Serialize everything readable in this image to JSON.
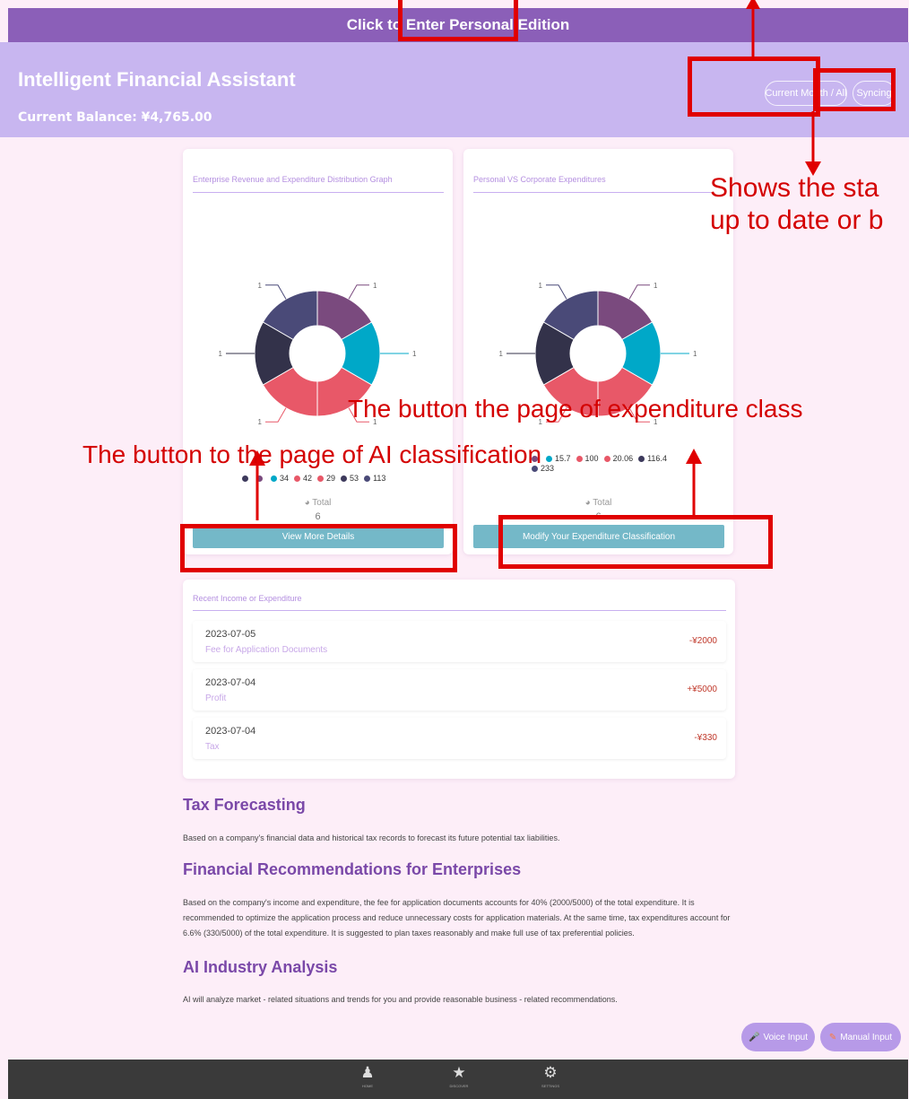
{
  "banner": {
    "text": "Click to Enter Personal Edition"
  },
  "header": {
    "title": "Intelligent Financial Assistant",
    "balance": "Current Balance: ¥4,765.00",
    "period_button": "Current Month / All",
    "sync_button": "Syncing"
  },
  "card1": {
    "title": "Enterprise Revenue and Expenditure Distribution Graph",
    "legend": [
      {
        "label": "",
        "color": "#3d3a5c"
      },
      {
        "label": "",
        "color": "#7a4a7e"
      },
      {
        "label": "34",
        "color": "#00a8c8"
      },
      {
        "label": "42",
        "color": "#e85868"
      },
      {
        "label": "29",
        "color": "#e85868"
      },
      {
        "label": "53",
        "color": "#3d3a5c"
      },
      {
        "label": "113",
        "color": "#4a4a78"
      }
    ],
    "total_label": "Total",
    "total_value": "6",
    "button": "View More Details"
  },
  "card2": {
    "title": "Personal VS Corporate Expenditures",
    "legend": [
      {
        "label": "",
        "color": "#7a4a7e"
      },
      {
        "label": "15.7",
        "color": "#00a8c8"
      },
      {
        "label": "100",
        "color": "#e85868"
      },
      {
        "label": "20.06",
        "color": "#e85868"
      },
      {
        "label": "116.4",
        "color": "#3d3a5c"
      },
      {
        "label": "233",
        "color": "#4a4a78"
      }
    ],
    "total_label": "Total",
    "total_value": "6",
    "button": "Modify Your Expenditure Classification"
  },
  "chart_data": [
    {
      "type": "pie",
      "title": "Enterprise Revenue and Expenditure Distribution Graph",
      "values": [
        1,
        1,
        1,
        1,
        1,
        1
      ],
      "labels": [
        "1",
        "1",
        "1",
        "1",
        "1",
        "1"
      ],
      "colors": [
        "#7a4a7e",
        "#00a8c8",
        "#e85868",
        "#e85868",
        "#33324a",
        "#4a4a78"
      ]
    },
    {
      "type": "pie",
      "title": "Personal VS Corporate Expenditures",
      "values": [
        1,
        1,
        1,
        1,
        1,
        1
      ],
      "labels": [
        "1",
        "1",
        "1",
        "1",
        "1",
        "1"
      ],
      "colors": [
        "#7a4a7e",
        "#00a8c8",
        "#e85868",
        "#e85868",
        "#33324a",
        "#4a4a78"
      ]
    }
  ],
  "recent": {
    "title": "Recent Income or Expenditure",
    "items": [
      {
        "date": "2023-07-05",
        "desc": "Fee for Application Documents",
        "amount": "-¥2000"
      },
      {
        "date": "2023-07-04",
        "desc": "Profit",
        "amount": "+¥5000"
      },
      {
        "date": "2023-07-04",
        "desc": "Tax",
        "amount": "-¥330"
      }
    ]
  },
  "sections": {
    "tax_title": "Tax Forecasting",
    "tax_text": "Based on a company's financial data and historical tax records to forecast its future potential tax liabilities.",
    "rec_title": "Financial Recommendations for Enterprises",
    "rec_text": "Based on the company's income and expenditure, the fee for application documents accounts for 40% (2000/5000) of the total expenditure. It is recommended to optimize the application process and reduce unnecessary costs for application materials. At the same time, tax expenditures account for 6.6% (330/5000) of the total expenditure. It is suggested to plan taxes reasonably and make full use of tax preferential policies.",
    "ai_title": "AI Industry Analysis",
    "ai_text": "AI will analyze market - related situations and trends for you and provide reasonable business - related recommendations."
  },
  "fab": {
    "voice": "Voice Input",
    "manual": "Manual Input"
  },
  "nav": {
    "home": "HOME",
    "discover": "DISCOVER",
    "settings": "SETTINGS"
  },
  "annotations": {
    "status_text": "Shows the sta up to date or b",
    "status_line1": "Shows the sta",
    "status_line2": "up to date or b",
    "expenditure_button": "The button the page of expenditure class",
    "ai_button": "The button to the page of AI classification"
  }
}
